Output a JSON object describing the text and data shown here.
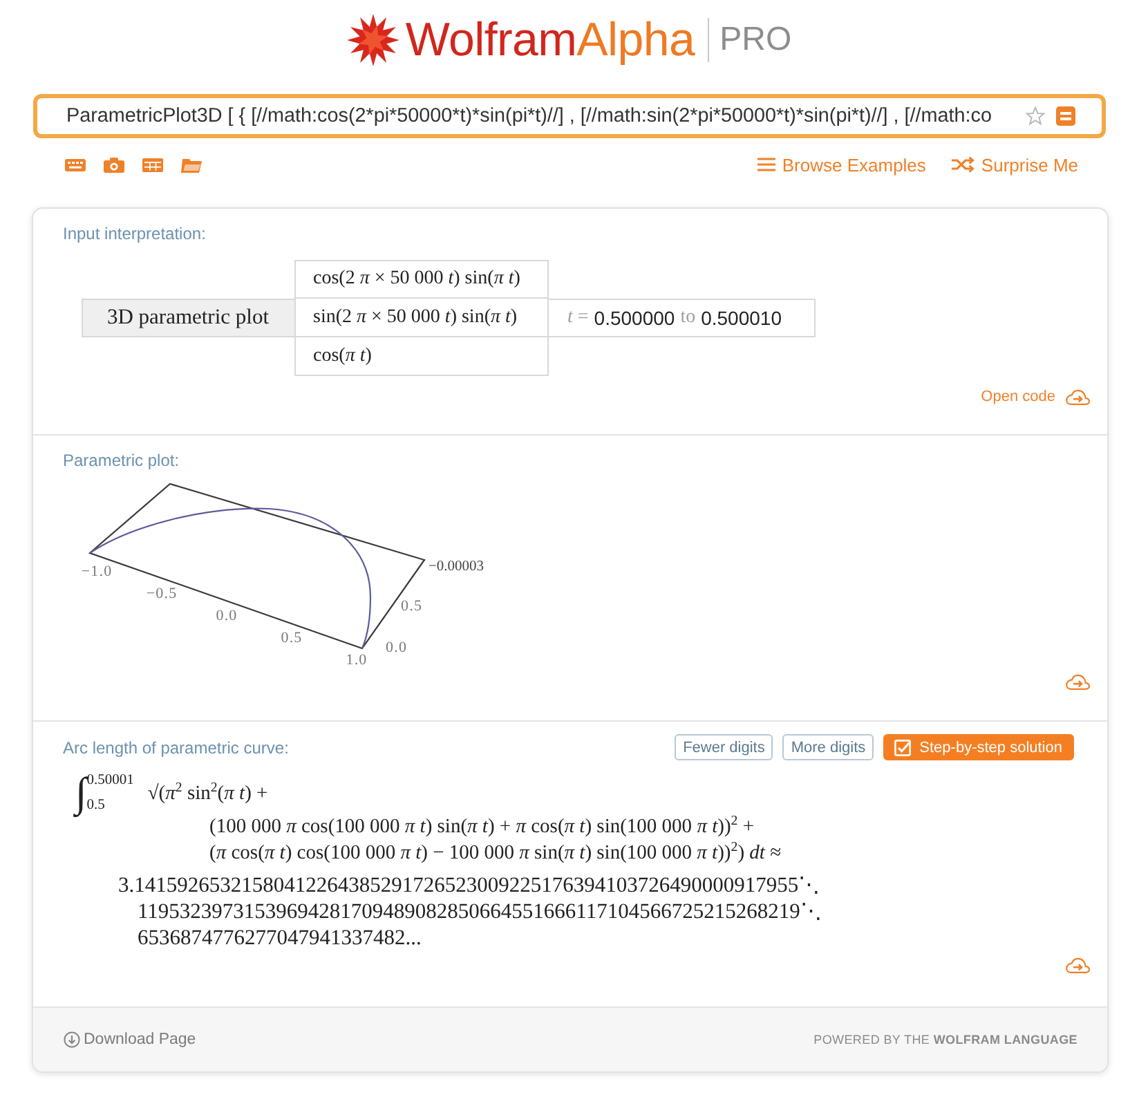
{
  "logo": {
    "wordmark": [
      "Wolfram",
      "Alpha"
    ],
    "edition": "PRO"
  },
  "search": {
    "value": "ParametricPlot3D [ { [//math:cos(2*pi*50000*t)*sin(pi*t)//] , [//math:sin(2*pi*50000*t)*sin(pi*t)//] , [//math:co"
  },
  "toolbar": {
    "links": [
      {
        "kind": "browse",
        "label": "Browse Examples"
      },
      {
        "kind": "surprise",
        "label": "Surprise Me"
      }
    ]
  },
  "pods": [
    {
      "kind": "interpretation",
      "title": "Input interpretation:",
      "label": "3D parametric plot",
      "components": [
        "cos(2 *π* × 50 000 *t*) sin(*π t*)",
        "sin(2 *π* × 50 000 *t*) sin(*π t*)",
        "cos(*π t*)"
      ],
      "range": {
        "lead": "*t* =",
        "from": "0.500000",
        "joiner": "to",
        "to": "0.500010"
      },
      "link": "Open code"
    },
    {
      "kind": "plot",
      "title": "Parametric plot:",
      "plot": {
        "x_ticks": [
          "−1.0",
          "−0.5",
          "0.0",
          "0.5",
          "1.0"
        ],
        "y_ticks": [
          "0.0",
          "0.5"
        ],
        "z_tick": "−0.00003"
      }
    },
    {
      "kind": "result",
      "title": "Arc length of parametric curve:",
      "buttons": [
        {
          "kind": "fewer",
          "label": "Fewer digits"
        },
        {
          "kind": "more",
          "label": "More digits"
        },
        {
          "kind": "steps",
          "label": "Step-by-step solution"
        }
      ],
      "integral": {
        "sign": "∫",
        "upper": "0.50001",
        "lower": "0.5",
        "lines": [
          "√(*π*$^{2}$ sin$^{2}$(*π t*) +",
          "(100 000 *π* cos(100 000 *π t*) sin(*π t*) + *π* cos(*π t*) sin(100 000 *π t*))$^{2}$ +",
          "(*π* cos(*π t*) cos(100 000 *π t*) − 100 000 *π* sin(*π t*) sin(100 000 *π t*))$^{2}$) *dt* ≈"
        ]
      },
      "digits": [
        "3.14159265321580412264385291726523009225176394103726490000917955⋱",
        "11953239731539694281709489082850664551666117104566725215268219⋱",
        "6536874776277047941337482..."
      ]
    }
  ],
  "footer": {
    "download": "Download Page",
    "powered": "POWERED BY THE **WOLFRAM LANGUAGE**"
  }
}
